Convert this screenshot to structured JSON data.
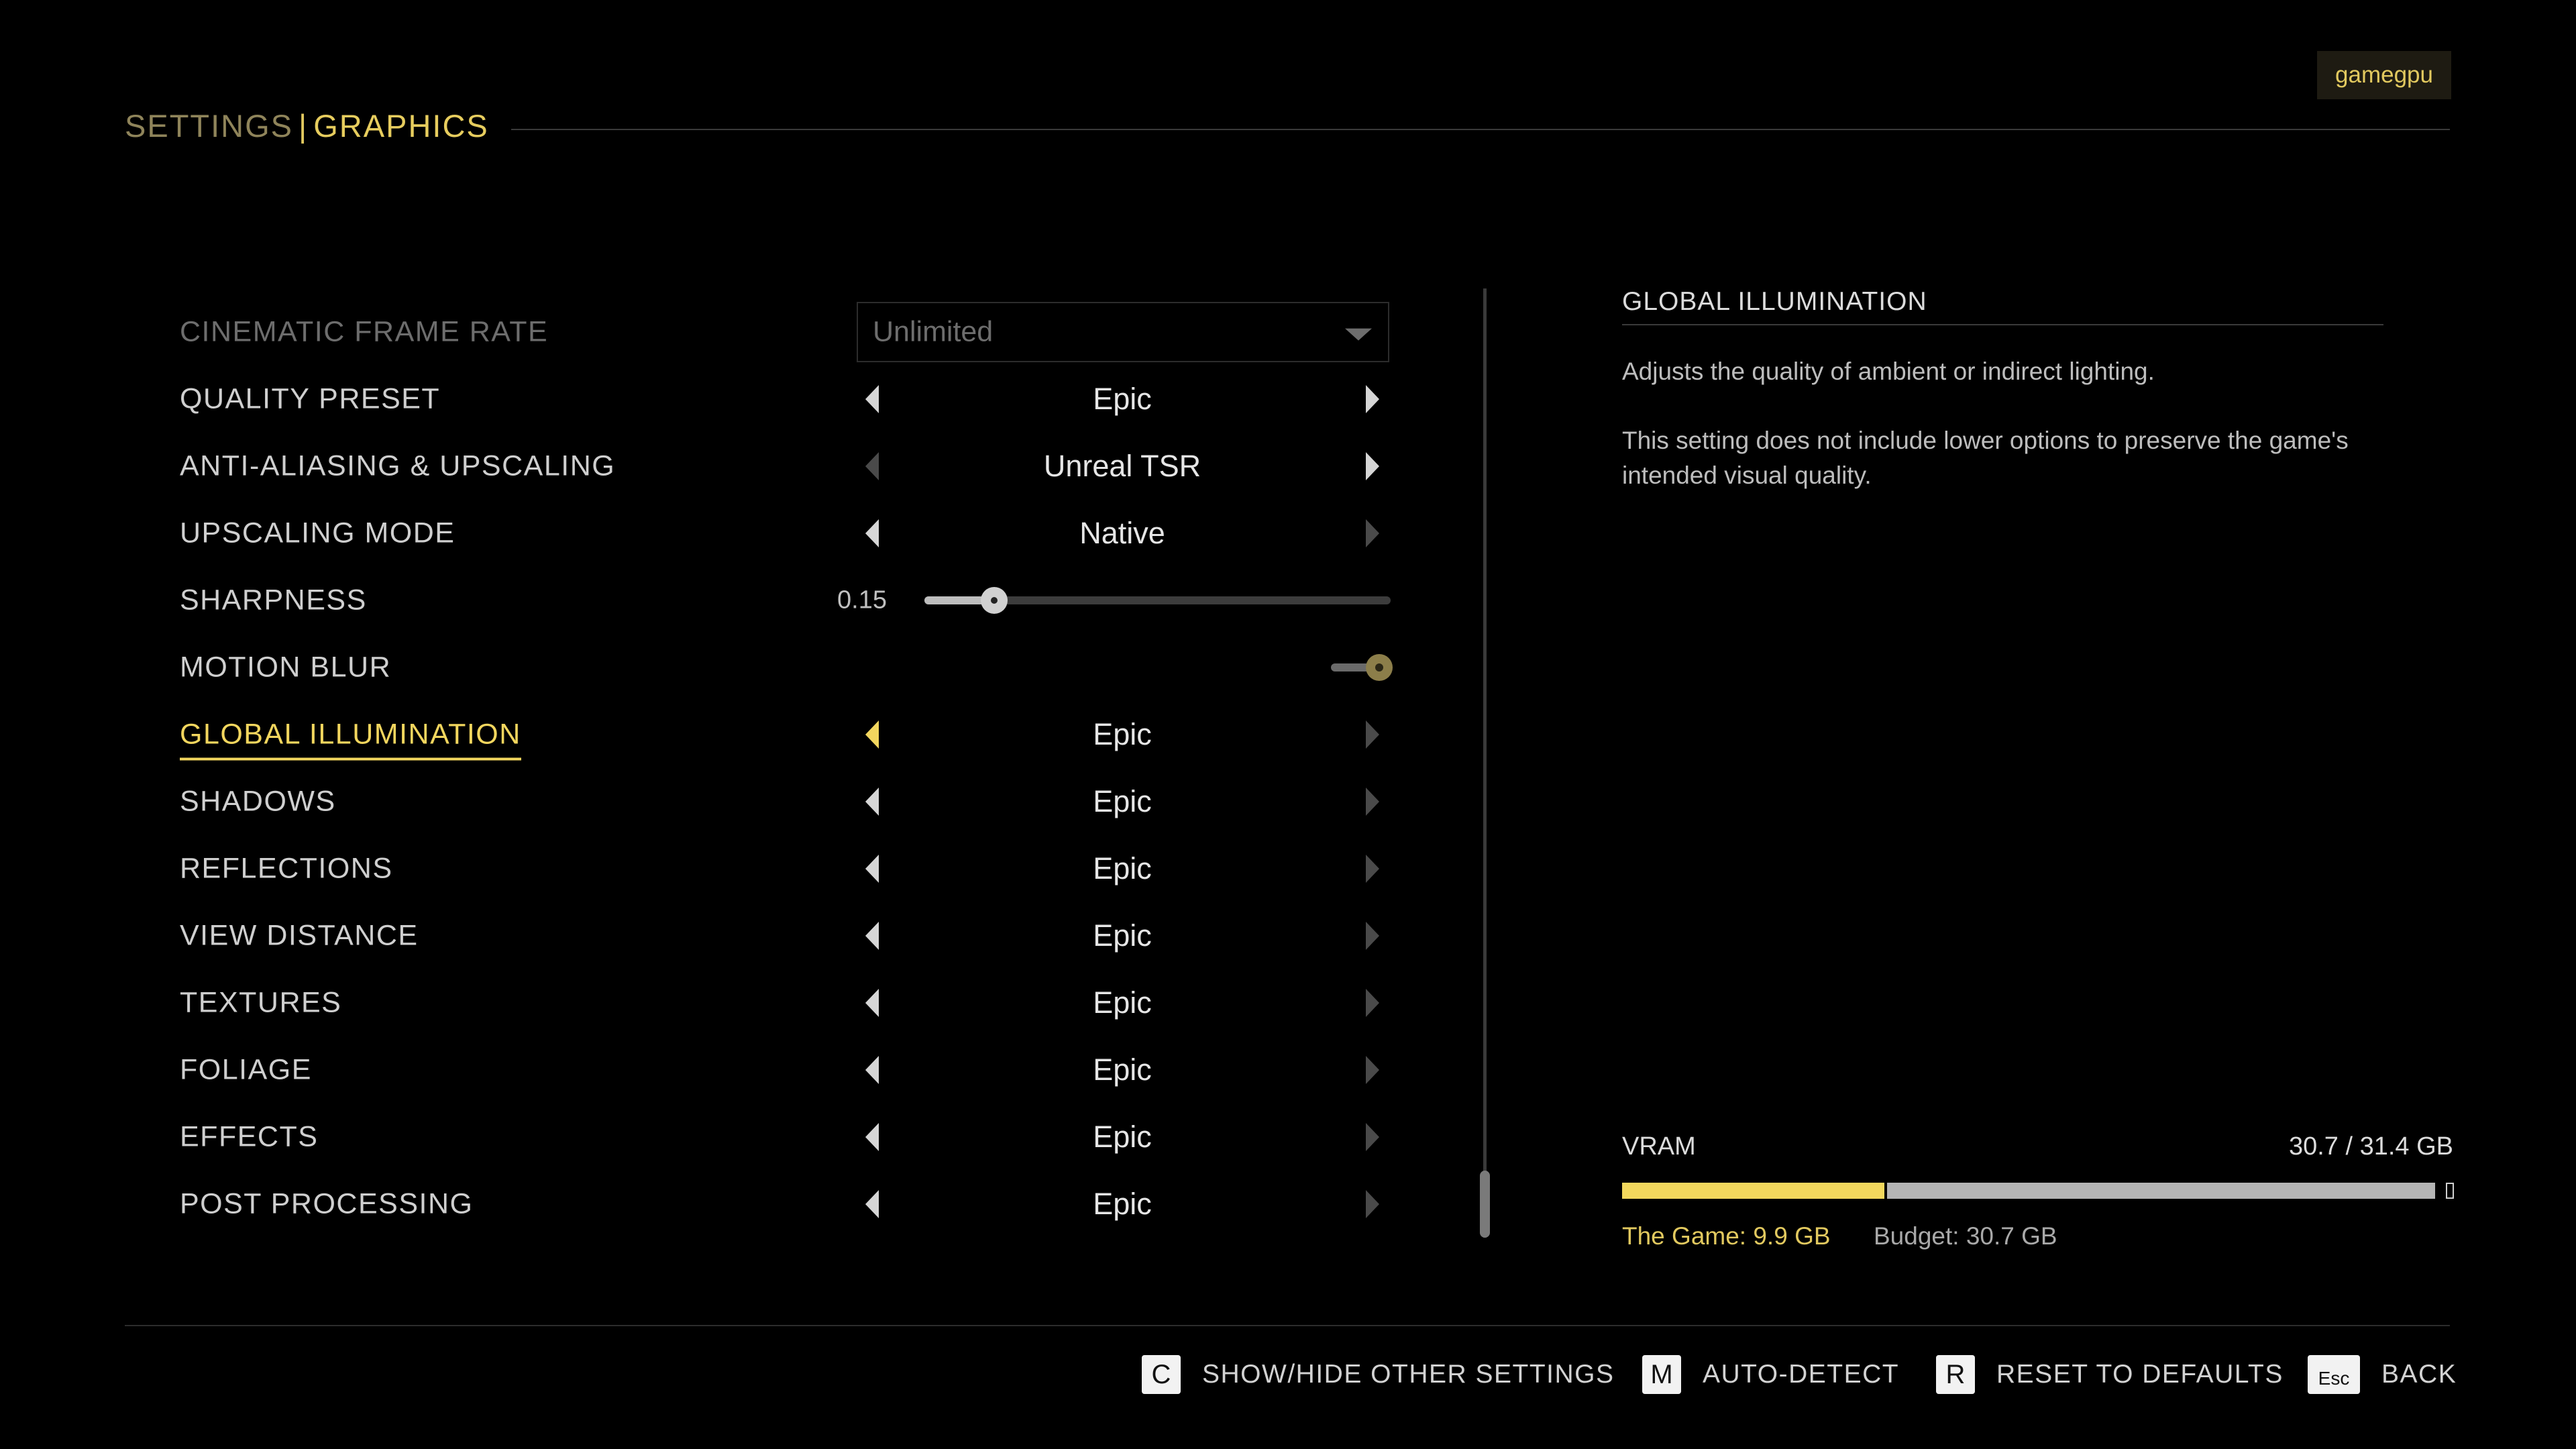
{
  "header": {
    "section": "SETTINGS",
    "separator": "|",
    "page": "GRAPHICS"
  },
  "watermark": "gamegpu",
  "settings": [
    {
      "label": "CINEMATIC FRAME RATE",
      "type": "dropdown",
      "value": "Unlimited",
      "disabled": true
    },
    {
      "label": "QUALITY PRESET",
      "type": "selector",
      "value": "Epic"
    },
    {
      "label": "ANTI-ALIASING & UPSCALING",
      "type": "selector",
      "value": "Unreal TSR"
    },
    {
      "label": "UPSCALING MODE",
      "type": "selector",
      "value": "Native"
    },
    {
      "label": "SHARPNESS",
      "type": "slider",
      "value": "0.15",
      "fraction": 0.15
    },
    {
      "label": "MOTION BLUR",
      "type": "toggle",
      "on": true
    },
    {
      "label": "GLOBAL ILLUMINATION",
      "type": "selector",
      "value": "Epic",
      "active": true
    },
    {
      "label": "SHADOWS",
      "type": "selector",
      "value": "Epic"
    },
    {
      "label": "REFLECTIONS",
      "type": "selector",
      "value": "Epic"
    },
    {
      "label": "VIEW DISTANCE",
      "type": "selector",
      "value": "Epic"
    },
    {
      "label": "TEXTURES",
      "type": "selector",
      "value": "Epic"
    },
    {
      "label": "FOLIAGE",
      "type": "selector",
      "value": "Epic"
    },
    {
      "label": "EFFECTS",
      "type": "selector",
      "value": "Epic"
    },
    {
      "label": "POST PROCESSING",
      "type": "selector",
      "value": "Epic"
    }
  ],
  "description": {
    "title": "GLOBAL ILLUMINATION",
    "text1": "Adjusts the quality of ambient or indirect lighting.",
    "text2": "This setting does not include lower options to preserve the game's intended visual quality."
  },
  "vram": {
    "label": "VRAM",
    "total": "30.7 / 31.4 GB",
    "game_label": "The Game: 9.9 GB",
    "budget_label": "Budget: 30.7 GB",
    "game_gb": 9.9,
    "budget_gb": 30.7,
    "capacity_gb": 31.4
  },
  "footer": {
    "show_hide": {
      "key": "C",
      "label": "SHOW/HIDE OTHER SETTINGS"
    },
    "auto_detect": {
      "key": "M",
      "label": "AUTO-DETECT"
    },
    "reset": {
      "key": "R",
      "label": "RESET TO DEFAULTS"
    },
    "back": {
      "key": "Esc",
      "label": "BACK"
    }
  },
  "colors": {
    "accent": "#f2d65e",
    "background": "#000000",
    "vram_game": "#f3d85d",
    "vram_budget": "#b5b5b5"
  }
}
